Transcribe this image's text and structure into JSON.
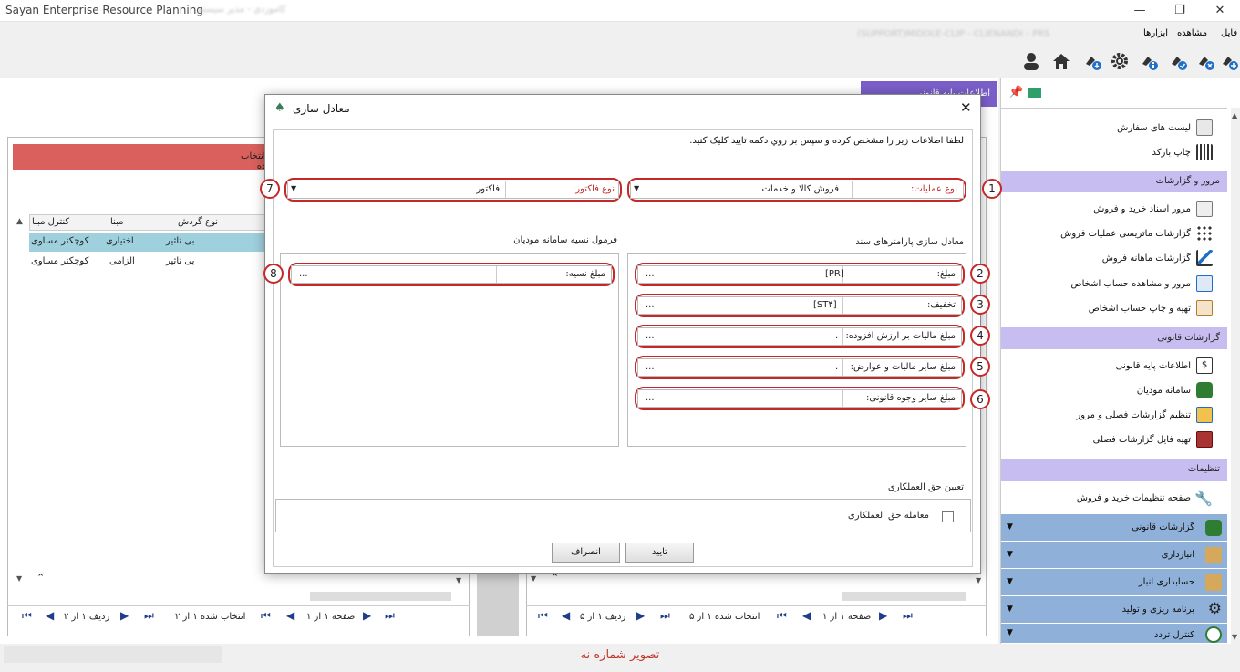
{
  "window": {
    "title": "Sayan Enterprise Resource Planning",
    "subtitle": "کاموردی - مدیر سیستم"
  },
  "menu": {
    "items": [
      "فایل",
      "مشاهده",
      "ابزارها"
    ],
    "blurred_info": "(SUPPORT)MIDDLE-CLIP - CLIENANDI - PRS"
  },
  "toolbar": {
    "icons": [
      "user-icon",
      "home-icon",
      "plug-down-icon",
      "gear-icon",
      "plug-info-icon",
      "plug-check-icon",
      "plug-remove-icon",
      "plug-add-icon"
    ]
  },
  "left_panel": {
    "banner": "رد انتخاب نشده",
    "columns": [
      "نوع گردش",
      "مبنا",
      "کنترل مبنا"
    ],
    "rows": [
      {
        "type": "بی تاثیر",
        "basis": "اختیاری",
        "control": "کوچکتر مساوی"
      },
      {
        "type": "بی تاثیر",
        "basis": "الزامی",
        "control": "کوچکتر مساوی"
      }
    ],
    "nav": {
      "row": "ردیف ۱ از ۲",
      "selected": "انتخاب شده ۱ از ۲",
      "page": "صفحه ۱ از ۱"
    }
  },
  "right_panel": {
    "nav": {
      "row": "ردیف ۱ از ۵",
      "selected": "انتخاب شده ۱ از ۵",
      "page": "صفحه ۱ از ۱"
    }
  },
  "sidebar": {
    "top_items": [
      {
        "label": "لیست های سفارش"
      },
      {
        "label": "چاپ بارکد"
      }
    ],
    "sections": [
      {
        "title": "مرور و گزارشات",
        "items": [
          "مرور اسناد خرید و فروش",
          "گزارشات ماتریسی عملیات فروش",
          "گزارشات ماهانه فروش",
          "مرور و مشاهده حساب اشخاص",
          "تهیه و چاپ حساب اشخاص"
        ]
      },
      {
        "title": "گزارشات قانونی",
        "items": [
          "اطلاعات پایه قانونی",
          "سامانه مودیان",
          "تنظیم گزارشات فصلی و مرور",
          "تهیه فایل گزارشات فصلی"
        ]
      },
      {
        "title": "تنظیمات",
        "items": [
          "صفحه تنظیمات خرید و فروش"
        ]
      }
    ],
    "bottom": [
      "گزارشات قانونی",
      "انبارداری",
      "حسابداری انبار",
      "برنامه ریزی و تولید",
      "کنترل تردد"
    ],
    "header_tab": "اطلاعات پایه قانونی"
  },
  "dialog": {
    "title": "معادل سازی",
    "instruction": "لطفا اطلاعات زیر را مشخص کرده و سپس بر روي دکمه تایید کلیک کنید.",
    "operation_label": "نوع عملیات:",
    "operation_value": "فروش کالا و خدمات",
    "invoice_label": "نوع فاکتور:",
    "invoice_value": "فاکتور",
    "left_group_title": "معادل سازی پارامترهای سند",
    "right_group_title": "فرمول نسیه سامانه مودیان",
    "params": [
      {
        "label": "مبلغ:",
        "value": "[PR]",
        "btn": "..."
      },
      {
        "label": "تخفیف:",
        "value": "[ST۴]",
        "btn": "..."
      },
      {
        "label": "مبلغ مالیات بر ارزش افزوده:",
        "value": ".",
        "btn": "..."
      },
      {
        "label": "مبلغ سایر مالیات و عوارض:",
        "value": ".",
        "btn": "..."
      },
      {
        "label": "مبلغ سایر وجوه قانونی:",
        "value": "",
        "btn": "..."
      }
    ],
    "credit_label": "مبلغ نسیه:",
    "credit_btn": "...",
    "commission_title": "تعیین حق العملکاری",
    "commission_checkbox": "معامله حق العملکاری",
    "ok": "تایید",
    "cancel": "انصراف",
    "badges": [
      "1",
      "2",
      "3",
      "4",
      "5",
      "6",
      "7",
      "8"
    ]
  },
  "caption": "تصویر شماره نه"
}
